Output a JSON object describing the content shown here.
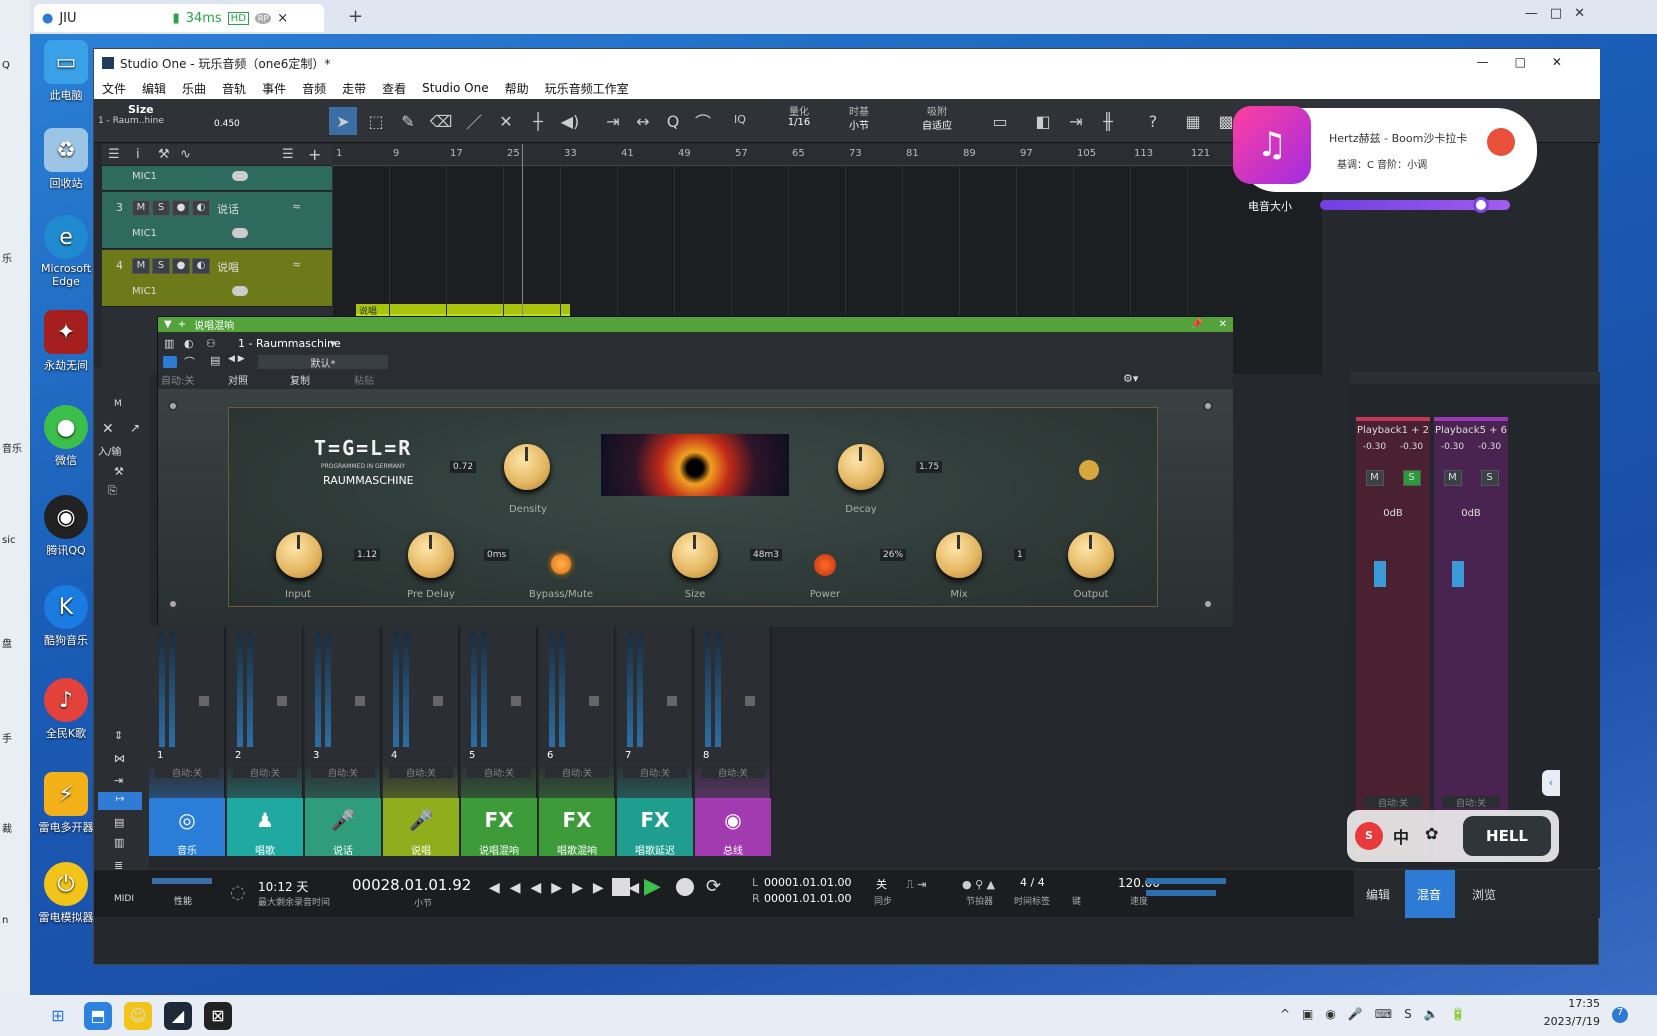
{
  "browser": {
    "tab_title": "JIU",
    "latency": "34ms",
    "hd": "HD",
    "rp": "RP",
    "close": "×",
    "newtab": "+"
  },
  "desktop": {
    "icons": [
      "此电脑",
      "回收站",
      "Microsoft Edge",
      "永劫无间",
      "微信",
      "腾讯QQ",
      "酷狗音乐",
      "全民K歌",
      "雷电多开器",
      "雷电模拟器"
    ],
    "left_strip": [
      "Q",
      "乐",
      "音乐",
      "sic",
      "盘",
      "手",
      "裁",
      "n"
    ]
  },
  "window": {
    "title": "Studio One - 玩乐音频（one6定制）*",
    "menu": [
      "文件",
      "编辑",
      "乐曲",
      "音轨",
      "事件",
      "音频",
      "走带",
      "查看",
      "Studio One",
      "帮助",
      "玩乐音频工作室"
    ]
  },
  "toolbar": {
    "size_label": "Size",
    "track_label": "1 - Raum..hine",
    "size_value": "0.450",
    "iq": "IQ",
    "quantize_label": "量化",
    "quantize_value": "1/16",
    "timebase_label": "时基",
    "timebase_value": "小节",
    "snap_label": "吸附",
    "snap_value": "自适应",
    "help": "?"
  },
  "tracks": [
    {
      "num": "",
      "name": "",
      "input": "MIC1"
    },
    {
      "num": "3",
      "name": "说话",
      "input": "MIC1"
    },
    {
      "num": "4",
      "name": "说唱",
      "input": "MIC1"
    }
  ],
  "track_buttons": {
    "m": "M",
    "s": "S"
  },
  "ruler": [
    "1",
    "9",
    "17",
    "25",
    "33",
    "41",
    "49",
    "57",
    "65",
    "73",
    "81",
    "89",
    "97",
    "105",
    "113",
    "121"
  ],
  "clip": {
    "name": "说唱"
  },
  "plugin": {
    "window_name": "说唱混响",
    "instance": "1 - Raummaschine",
    "preset": "默认*",
    "auto": "自动:关",
    "compare": "对照",
    "copy": "复制",
    "paste": "粘贴",
    "brand": "T=G=L=R",
    "programmed": "PROGRAMMED IN GERMANY",
    "product": "RAUMMASCHINE",
    "knobs": [
      {
        "label": "Density",
        "value": "0.72"
      },
      {
        "label": "Decay",
        "value": "1.75"
      },
      {
        "label": "Input",
        "value": "1.12"
      },
      {
        "label": "Pre Delay",
        "value": "0ms"
      },
      {
        "label": "Size",
        "value": "48m3"
      },
      {
        "label": "Mix",
        "value": "26%"
      },
      {
        "label": "Output",
        "value": "1"
      }
    ],
    "bypass_label": "Bypass/Mute",
    "power_label": "Power",
    "scale": {
      "min": "0",
      "max": "10",
      "t2": "2",
      "t4": "4",
      "t6": "6",
      "t8": "8"
    }
  },
  "side_panel": {
    "inout": "入/输",
    "m": "M"
  },
  "mixer": {
    "channels": [
      {
        "num": "1",
        "name": "音乐",
        "icon": "speaker",
        "color": "#2a7ed8",
        "auto": "自动:关"
      },
      {
        "num": "2",
        "name": "唱歌",
        "icon": "singer",
        "color": "#20a9a0",
        "auto": "自动:关"
      },
      {
        "num": "3",
        "name": "说话",
        "icon": "mic",
        "color": "#2f9d7c",
        "auto": "自动:关"
      },
      {
        "num": "4",
        "name": "说唱",
        "icon": "mic",
        "color": "#8fae1d",
        "auto": "自动:关"
      },
      {
        "num": "5",
        "name": "说唱混响",
        "icon": "FX",
        "color": "#3e9b3a",
        "auto": "自动:关"
      },
      {
        "num": "6",
        "name": "唱歌混响",
        "icon": "FX",
        "color": "#3e9b3a",
        "auto": "自动:关"
      },
      {
        "num": "7",
        "name": "唱歌延迟",
        "icon": "FX",
        "color": "#1f9e8f",
        "auto": "自动:关"
      },
      {
        "num": "8",
        "name": "总线",
        "icon": "bus",
        "color": "#a33bb0",
        "auto": "自动:关"
      }
    ],
    "right": [
      {
        "name": "Playback1 + 2",
        "l": "-0.30",
        "r": "-0.30",
        "db": "0dB",
        "auto": "自动:关"
      },
      {
        "name": "Playback5 + 6",
        "l": "-0.30",
        "r": "-0.30",
        "db": "0dB",
        "auto": "自动:关"
      }
    ],
    "meter_scale": [
      "6",
      "-12",
      "-24",
      "-36",
      "-48",
      "-60",
      "-72"
    ]
  },
  "transport": {
    "midi": "MIDI",
    "perf": "性能",
    "remaining": "10:12 天",
    "remaining_label": "最大剩余录音时间",
    "position": "00028.01.01.92",
    "position_label": "小节",
    "loop_l": "00001.01.01.00",
    "loop_r": "00001.01.01.00",
    "l": "L",
    "r": "R",
    "sync_val": "关",
    "sync": "同步",
    "metronome": "节拍器",
    "timesig": "4 / 4",
    "timesig_label": "时间标签",
    "key": "键",
    "tempo": "120.00",
    "tempo_label": "速度",
    "views": [
      "编辑",
      "混音",
      "浏览"
    ]
  },
  "overlay": {
    "song": "Hertz赫兹 - Boom沙卡拉卡",
    "key": "基调：C  音阶：小调",
    "volume_label": "电音大小",
    "volume_level": 0.86,
    "ime": [
      "中",
      "HELL"
    ]
  },
  "taskbar": {
    "time": "17:35",
    "date": "2023/7/19",
    "badge": "7"
  },
  "colors": {
    "accent": "#2e7bd6",
    "plugin_bar": "#53a33a",
    "clip": "#c3e018",
    "mix_active": "#2e7bd6"
  }
}
